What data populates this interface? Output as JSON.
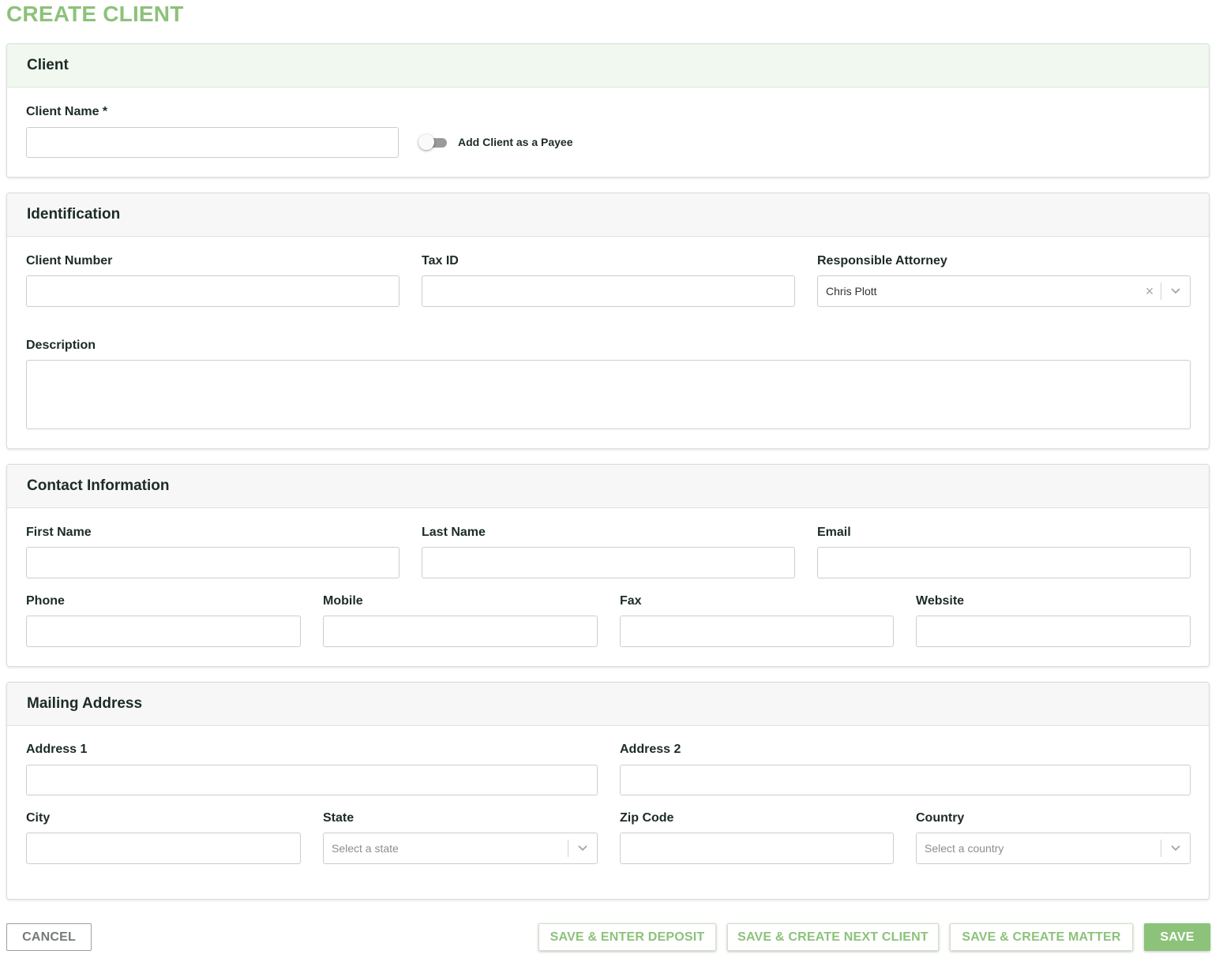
{
  "page": {
    "title": "CREATE CLIENT"
  },
  "client_section": {
    "title": "Client",
    "client_name_label": "Client Name *",
    "client_name_value": "",
    "payee_toggle_label": "Add Client as a Payee",
    "payee_toggle_on": false
  },
  "identification_section": {
    "title": "Identification",
    "client_number_label": "Client Number",
    "tax_id_label": "Tax ID",
    "responsible_attorney_label": "Responsible Attorney",
    "responsible_attorney_value": "Chris Plott",
    "description_label": "Description"
  },
  "contact_section": {
    "title": "Contact Information",
    "first_name_label": "First Name",
    "last_name_label": "Last Name",
    "email_label": "Email",
    "phone_label": "Phone",
    "mobile_label": "Mobile",
    "fax_label": "Fax",
    "website_label": "Website"
  },
  "mailing_section": {
    "title": "Mailing Address",
    "address1_label": "Address 1",
    "address2_label": "Address 2",
    "city_label": "City",
    "state_label": "State",
    "state_placeholder": "Select a state",
    "zip_label": "Zip Code",
    "country_label": "Country",
    "country_placeholder": "Select a country"
  },
  "actions": {
    "cancel": "CANCEL",
    "save_enter_deposit": "SAVE & ENTER DEPOSIT",
    "save_create_next_client": "SAVE & CREATE NEXT CLIENT",
    "save_create_matter": "SAVE & CREATE MATTER",
    "save": "SAVE"
  },
  "colors": {
    "accent": "#8cc27a",
    "client_header_bg": "#f1f8ef",
    "section_header_bg": "#f6f7f6"
  },
  "icons": {
    "clear": "close-icon",
    "dropdown": "chevron-down-icon"
  }
}
